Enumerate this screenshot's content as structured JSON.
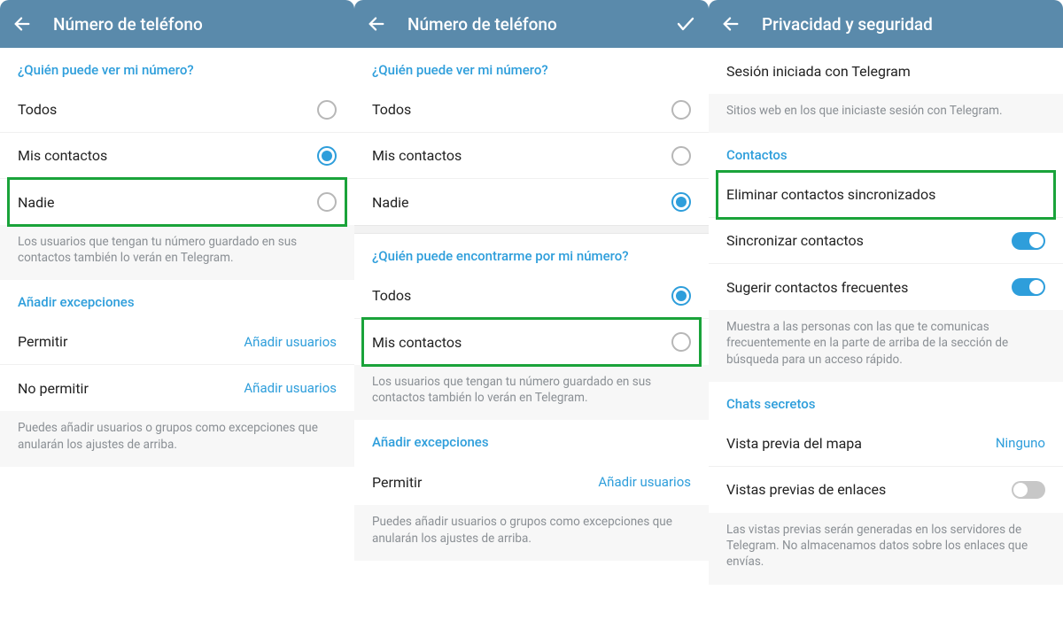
{
  "panel1": {
    "title": "Número de teléfono",
    "q_see": "¿Quién puede ver mi número?",
    "opts": {
      "everyone": "Todos",
      "contacts": "Mis contactos",
      "nobody": "Nadie"
    },
    "see_hint": "Los usuarios que tengan tu número guardado en sus contactos también lo verán en Telegram.",
    "exceptions_title": "Añadir excepciones",
    "allow": "Permitir",
    "deny": "No permitir",
    "add_users": "Añadir usuarios",
    "exceptions_hint": "Puedes añadir usuarios o grupos como excepciones que anularán los ajustes de arriba."
  },
  "panel2": {
    "title": "Número de teléfono",
    "q_see": "¿Quién puede ver mi número?",
    "opts": {
      "everyone": "Todos",
      "contacts": "Mis contactos",
      "nobody": "Nadie"
    },
    "q_find": "¿Quién puede encontrarme por mi número?",
    "find_hint": "Los usuarios que tengan tu número guardado en sus contactos también lo verán en Telegram.",
    "exceptions_title": "Añadir excepciones",
    "allow": "Permitir",
    "add_users": "Añadir usuarios",
    "exceptions_hint": "Puedes añadir usuarios o grupos como excepciones que anularán los ajustes de arriba."
  },
  "panel3": {
    "title": "Privacidad y seguridad",
    "sessions_row": "Sesión iniciada con Telegram",
    "sessions_hint": "Sitios web en los que iniciaste sesión con Telegram.",
    "contacts_title": "Contactos",
    "delete_synced": "Eliminar contactos sincronizados",
    "sync_contacts": "Sincronizar contactos",
    "suggest_frequent": "Sugerir contactos frecuentes",
    "frequent_hint": "Muestra a las personas con las que te comunicas frecuentemente en la parte de arriba de la sección de búsqueda para un acceso rápido.",
    "secret_title": "Chats secretos",
    "map_preview": "Vista previa del mapa",
    "map_value": "Ninguno",
    "link_previews": "Vistas previas de enlaces",
    "link_hint": "Las vistas previas serán generadas en los servidores de Telegram. No almacenamos datos sobre los enlaces que envías."
  }
}
